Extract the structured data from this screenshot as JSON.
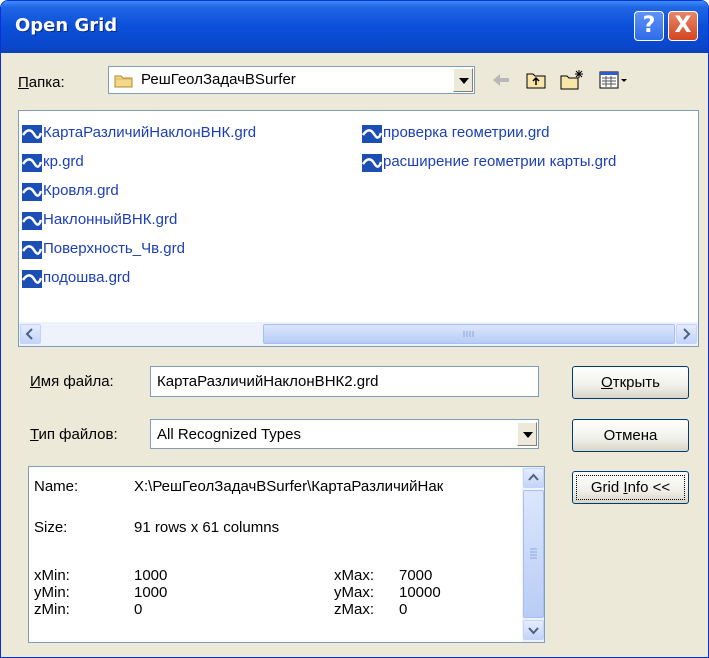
{
  "window": {
    "title": "Open Grid"
  },
  "folder": {
    "label_u": "П",
    "label_rest": "апка:",
    "value": "РешГеолЗадачBSurfer"
  },
  "files": [
    "КартаРазличийНаклонВНК.grd",
    "кр.grd",
    "Кровля.grd",
    "НаклонныйВНК.grd",
    "Поверхность_Чв.grd",
    "подошва.grd",
    "проверка геометрии.grd",
    "расширение геометрии карты.grd"
  ],
  "filename": {
    "label_u": "И",
    "label_rest": "мя файла:",
    "value": "КартаРазличийНаклонВНК2.grd"
  },
  "filetype": {
    "label_u": "Т",
    "label_rest": "ип файлов:",
    "value": "All Recognized Types"
  },
  "buttons": {
    "open_u": "О",
    "open_rest": "ткрыть",
    "cancel": "Отмена",
    "gridinfo_pre": "Grid ",
    "gridinfo_u": "I",
    "gridinfo_rest": "nfo <<"
  },
  "info": {
    "name_label": "Name:",
    "name_value": "X:\\РешГеолЗадачBSurfer\\КартаРазличийНак",
    "size_label": "Size:",
    "size_value": "91 rows x 61 columns",
    "xmin_label": "xMin:",
    "xmin_value": "1000",
    "ymin_label": "yMin:",
    "ymin_value": "1000",
    "zmin_label": "zMin:",
    "zmin_value": "0",
    "xmax_label": "xMax:",
    "xmax_value": "7000",
    "ymax_label": "yMax:",
    "ymax_value": "10000",
    "zmax_label": "zMax:",
    "zmax_value": "0"
  },
  "colors": {
    "title_bar": "#0A46CB",
    "dialog_bg": "#ECE9D8",
    "file_text": "#1C3FB8",
    "grid_icon": "#1B4FB5"
  },
  "icons": {
    "help": "?",
    "close": "X",
    "file_icon": "grid-file-icon",
    "folder_icon": "folder-icon",
    "back": "back-arrow-icon",
    "up": "up-folder-icon",
    "new_folder": "new-folder-icon",
    "view_menu": "view-menu-icon"
  }
}
